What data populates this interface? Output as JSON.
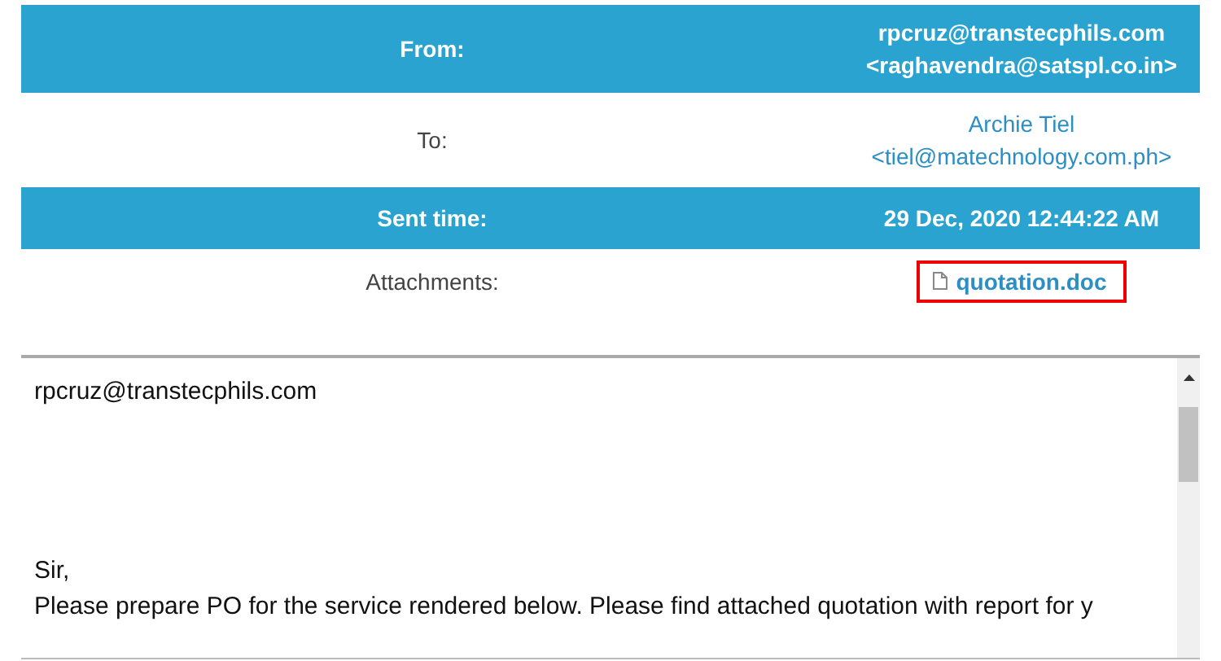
{
  "headers": [
    {
      "label": "From:",
      "kind": "highlight",
      "lines": [
        "rpcruz@transtecphils.com",
        "<raghavendra@satspl.co.in>"
      ]
    },
    {
      "label": "To:",
      "kind": "plain",
      "link": true,
      "lines": [
        "Archie Tiel",
        "<tiel@matechnology.com.ph>"
      ]
    },
    {
      "label": "Sent time:",
      "kind": "highlight",
      "lines": [
        "29 Dec, 2020 12:44:22 AM"
      ]
    },
    {
      "label": "Attachments:",
      "kind": "attachment",
      "highlighted": true,
      "lines": [
        "quotation.doc"
      ]
    }
  ],
  "body": {
    "paragraphs": [
      {
        "lines": [
          "rpcruz@transtecphils.com"
        ]
      },
      {
        "lines": [
          "Sir,",
          "Please prepare PO for the service rendered below. Please find attached quotation with report for y"
        ]
      }
    ]
  }
}
